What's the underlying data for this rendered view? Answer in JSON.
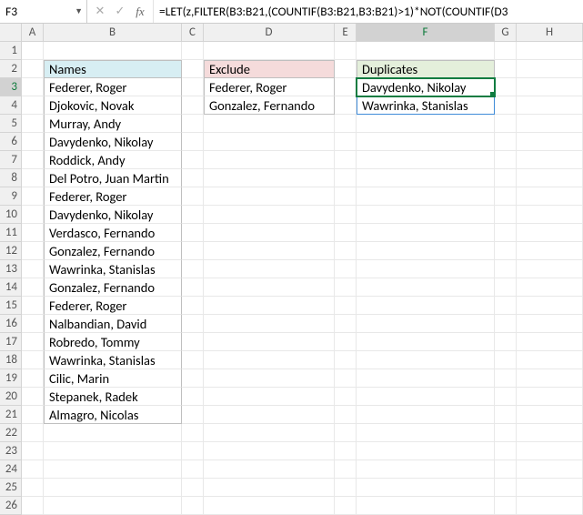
{
  "formula_bar": {
    "cell_ref": "F3",
    "formula": "=LET(z,FILTER(B3:B21,(COUNTIF(B3:B21,B3:B21)>1)*NOT(COUNTIF(D3"
  },
  "columns": [
    "A",
    "B",
    "C",
    "D",
    "E",
    "F",
    "G",
    "H"
  ],
  "row_count": 26,
  "headers": {
    "names": "Names",
    "exclude": "Exclude",
    "duplicates": "Duplicates"
  },
  "data": {
    "names": [
      "Federer, Roger",
      "Djokovic, Novak",
      "Murray, Andy",
      "Davydenko, Nikolay",
      "Roddick, Andy",
      "Del Potro, Juan Martin",
      "Federer, Roger",
      "Davydenko, Nikolay",
      "Verdasco, Fernando",
      "Gonzalez, Fernando",
      "Wawrinka, Stanislas",
      "Gonzalez, Fernando",
      "Federer, Roger",
      "Nalbandian, David",
      "Robredo, Tommy",
      "Wawrinka, Stanislas",
      "Cilic, Marin",
      "Stepanek, Radek",
      "Almagro, Nicolas"
    ],
    "exclude": [
      "Federer, Roger",
      "Gonzalez, Fernando"
    ],
    "duplicates": [
      "Davydenko, Nikolay",
      "Wawrinka, Stanislas"
    ]
  },
  "selected_cell": "F3",
  "active_col": "F",
  "active_row": 3
}
